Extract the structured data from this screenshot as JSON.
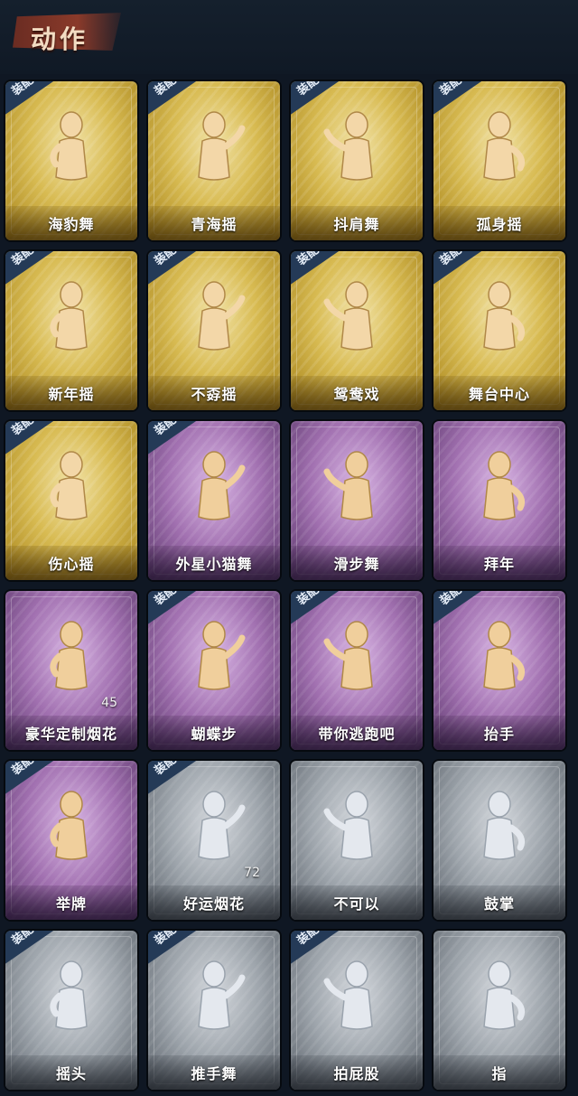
{
  "header": {
    "title": "动作"
  },
  "equipped_badge": "装配",
  "colors": {
    "gold": "#d8bb52",
    "purple": "#a170b0",
    "silver": "#9da4ab",
    "badge": "#243a57"
  },
  "cards": [
    {
      "name": "海豹舞",
      "tier": "gold",
      "equipped": true,
      "icon": "seal-dance-icon"
    },
    {
      "name": "青海摇",
      "tier": "gold",
      "equipped": true,
      "icon": "qinghai-shake-icon"
    },
    {
      "name": "抖肩舞",
      "tier": "gold",
      "equipped": true,
      "icon": "shoulder-shake-icon"
    },
    {
      "name": "孤身摇",
      "tier": "gold",
      "equipped": true,
      "icon": "solo-shake-icon"
    },
    {
      "name": "新年摇",
      "tier": "gold",
      "equipped": true,
      "icon": "new-year-shake-icon"
    },
    {
      "name": "不孬摇",
      "tier": "gold",
      "equipped": true,
      "icon": "not-bad-shake-icon"
    },
    {
      "name": "鸳鸯戏",
      "tier": "gold",
      "equipped": true,
      "icon": "mandarin-duck-icon"
    },
    {
      "name": "舞台中心",
      "tier": "gold",
      "equipped": true,
      "icon": "center-stage-icon"
    },
    {
      "name": "伤心摇",
      "tier": "gold",
      "equipped": true,
      "icon": "heartbreak-shake-icon"
    },
    {
      "name": "外星小猫舞",
      "tier": "purple",
      "equipped": true,
      "icon": "alien-cat-dance-icon"
    },
    {
      "name": "滑步舞",
      "tier": "purple",
      "equipped": false,
      "icon": "slide-dance-icon"
    },
    {
      "name": "拜年",
      "tier": "purple",
      "equipped": false,
      "icon": "new-year-greeting-icon"
    },
    {
      "name": "豪华定制烟花",
      "tier": "purple",
      "equipped": false,
      "icon": "deluxe-fireworks-icon",
      "count": "45"
    },
    {
      "name": "蝴蝶步",
      "tier": "purple",
      "equipped": true,
      "icon": "butterfly-step-icon"
    },
    {
      "name": "带你逃跑吧",
      "tier": "purple",
      "equipped": true,
      "icon": "run-away-icon"
    },
    {
      "name": "抬手",
      "tier": "purple",
      "equipped": true,
      "icon": "raise-hand-icon"
    },
    {
      "name": "举牌",
      "tier": "purple",
      "equipped": true,
      "icon": "hold-sign-icon"
    },
    {
      "name": "好运烟花",
      "tier": "silver",
      "equipped": true,
      "icon": "lucky-fireworks-icon",
      "count": "72"
    },
    {
      "name": "不可以",
      "tier": "silver",
      "equipped": false,
      "icon": "no-finger-icon"
    },
    {
      "name": "鼓掌",
      "tier": "silver",
      "equipped": false,
      "icon": "clap-hands-icon"
    },
    {
      "name": "摇头",
      "tier": "silver",
      "equipped": true,
      "icon": "head-shake-icon"
    },
    {
      "name": "推手舞",
      "tier": "silver",
      "equipped": true,
      "icon": "push-hand-dance-icon"
    },
    {
      "name": "拍屁股",
      "tier": "silver",
      "equipped": true,
      "icon": "butt-slap-icon"
    },
    {
      "name": "指",
      "tier": "silver",
      "equipped": false,
      "icon": "point-icon"
    }
  ]
}
